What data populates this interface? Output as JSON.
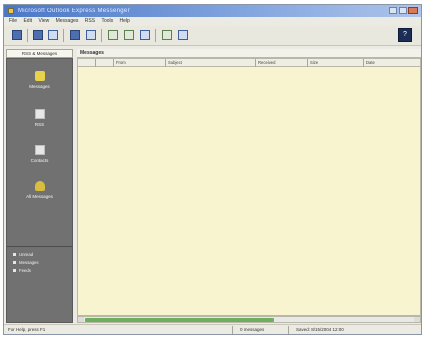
{
  "window": {
    "title": "Microsoft Outlook Express Messenger"
  },
  "menu": [
    "File",
    "Edit",
    "View",
    "Messages",
    "RSS",
    "Tools",
    "Help"
  ],
  "toolbar": {
    "help_label": "?"
  },
  "sidebar": {
    "tab_label": "RSS & Messages",
    "items": [
      {
        "label": "Messages",
        "icon": "envelope-icon"
      },
      {
        "label": "RSS",
        "icon": "feed-icon"
      },
      {
        "label": "Contacts",
        "icon": "contacts-icon"
      },
      {
        "label": "All Messages",
        "icon": "folder-icon"
      }
    ],
    "legend": [
      "Unread",
      "Messages",
      "Feeds"
    ]
  },
  "folder": {
    "title": "Messages"
  },
  "columns": [
    "",
    "",
    "From",
    "Subject",
    "Received",
    "Size",
    "Date"
  ],
  "status": {
    "left": "For Help, press F1",
    "mid": "0 messages",
    "right": "Saved: 8/15/2004 12:00"
  },
  "colors": {
    "list_bg": "#f7f4cf",
    "sidebar_bg": "#717171",
    "scroll_thumb": "#6fae5e"
  }
}
